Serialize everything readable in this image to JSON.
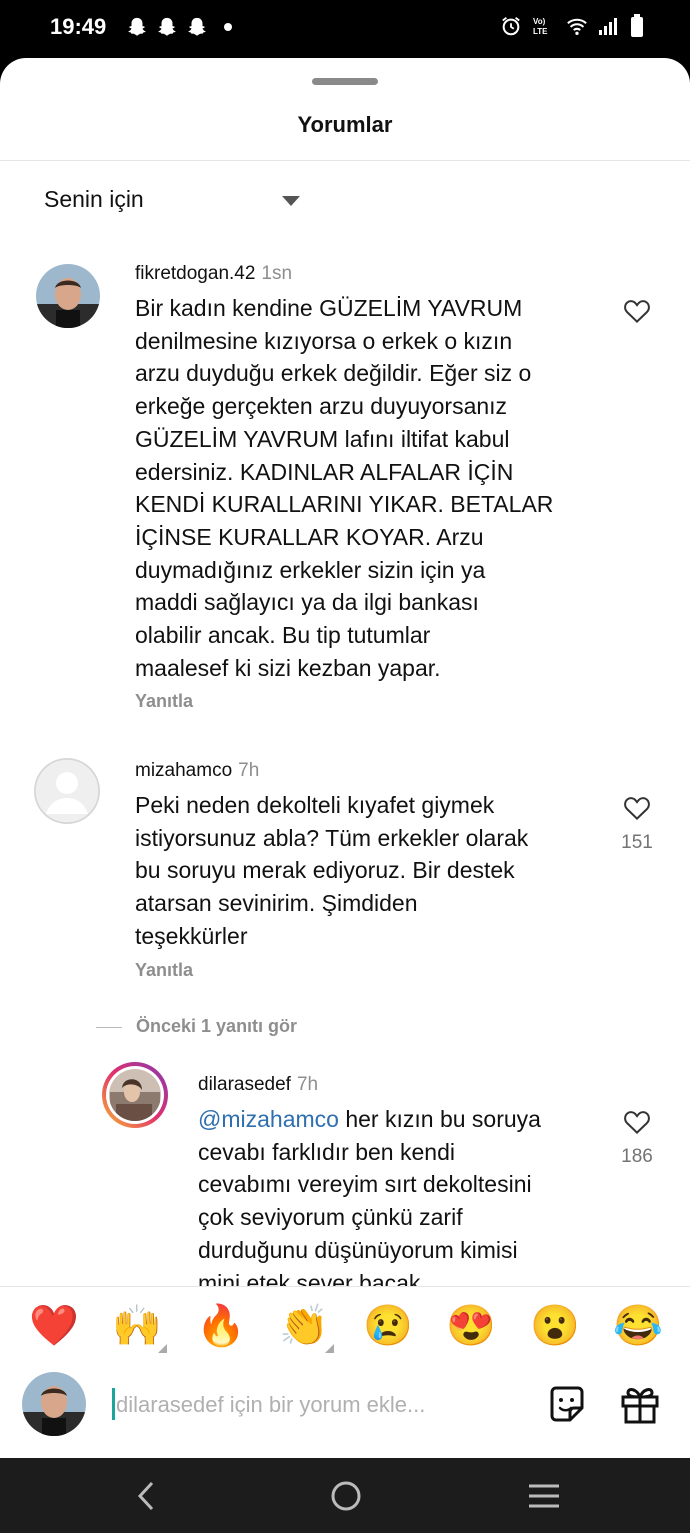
{
  "status": {
    "time": "19:49"
  },
  "sheet": {
    "title": "Yorumlar",
    "sort_label": "Senin için"
  },
  "comments": [
    {
      "username": "fikretdogan.42",
      "time": "1sn",
      "lines": [
        "Bir kadın kendine GÜZELİM YAVRUM",
        "denilmesine kızıyorsa o erkek o kızın",
        "arzu duyduğu erkek değildir. Eğer siz o",
        "erkeğe gerçekten arzu duyuyorsanız",
        "GÜZELİM YAVRUM lafını iltifat kabul",
        "edersiniz. KADINLAR ALFALAR İÇİN",
        "KENDİ KURALLARINI YIKAR. BETALAR",
        "İÇİNSE KURALLAR KOYAR. Arzu",
        "duymadığınız erkekler sizin için ya",
        "maddi sağlayıcı ya da ilgi bankası",
        "olabilir ancak. Bu tip tutumlar",
        "maalesef ki sizi kezban yapar."
      ],
      "reply_label": "Yanıtla"
    },
    {
      "username": "mizahamco",
      "time": "7h",
      "lines": [
        "Peki neden dekolteli kıyafet giymek",
        "istiyorsunuz abla? Tüm erkekler olarak",
        "bu soruyu merak ediyoruz. Bir destek",
        "atarsan sevinirim. Şimdiden",
        "teşekkürler"
      ],
      "reply_label": "Yanıtla",
      "likes": "151"
    }
  ],
  "view_replies": "Önceki 1 yanıtı gör",
  "reply": {
    "username": "dilarasedef",
    "time": "7h",
    "mention": "@mizahamco",
    "first_line_rest": " her kızın bu soruya",
    "lines": [
      "cevabı farklıdır ben kendi",
      "cevabımı vereyim sırt dekoltesini",
      "çok seviyorum çünkü zarif",
      "durduğunu düşünüyorum kimisi",
      "mini etek sever bacak"
    ],
    "likes": "186"
  },
  "emojis": [
    "❤️",
    "🙌",
    "🔥",
    "👏",
    "😢",
    "😍",
    "😮",
    "😂"
  ],
  "input": {
    "placeholder": "dilarasedef için bir yorum ekle..."
  }
}
